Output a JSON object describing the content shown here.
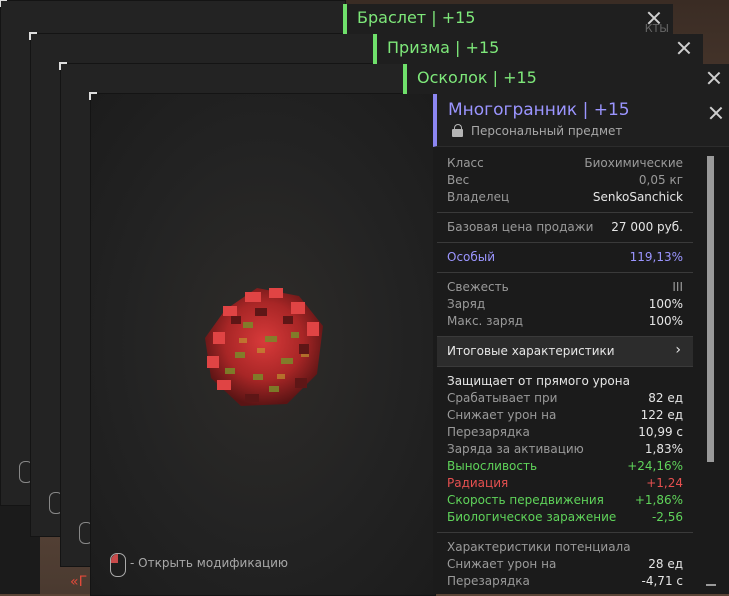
{
  "background": {
    "partial_text": "«Г"
  },
  "stack_tabs": [
    {
      "title": "Браслет | +15",
      "ghost": "КТЫ"
    },
    {
      "title": "Призма | +15"
    },
    {
      "title": "Осколок | +15"
    }
  ],
  "item": {
    "title": "Многогранник | +15",
    "subtitle": "Персональный предмет",
    "info": [
      {
        "k": "Класс",
        "v": "Биохимические"
      },
      {
        "k": "Вес",
        "v": "0,05 кг"
      },
      {
        "k": "Владелец",
        "v": "SenkoSanchick"
      }
    ],
    "price": {
      "k": "Базовая цена продажи",
      "v": "27 000 руб."
    },
    "special": {
      "k": "Особый",
      "v": "119,13%"
    },
    "charge": [
      {
        "k": "Свежесть",
        "v": "III"
      },
      {
        "k": "Заряд",
        "v": "100%"
      },
      {
        "k": "Макс. заряд",
        "v": "100%"
      }
    ],
    "totals_label": "Итоговые характеристики",
    "protect_title": "Защищает от прямого урона",
    "protect": [
      {
        "k": "Срабатывает при",
        "v": "82 ед"
      },
      {
        "k": "Снижает урон на",
        "v": "122 ед"
      },
      {
        "k": "Перезарядка",
        "v": "10,99 с"
      },
      {
        "k": "Заряда за активацию",
        "v": "1,83%"
      },
      {
        "k": "Выносливость",
        "v": "+24,16%"
      },
      {
        "k": "Радиация",
        "v": "+1,24"
      },
      {
        "k": "Скорость передвижения",
        "v": "+1,86%"
      },
      {
        "k": "Биологическое заражение",
        "v": "-2,56"
      }
    ],
    "potential_title": "Характеристики потенциала",
    "potential": [
      {
        "k": "Снижает урон на",
        "v": "28 ед"
      },
      {
        "k": "Перезарядка",
        "v": "-4,71 с"
      }
    ]
  },
  "hint": "- Открыть модификацию",
  "colors": {
    "accent_green": "#6fe06b",
    "accent_purple": "#8c86f2",
    "positive": "#5fd35a",
    "negative": "#e65050"
  },
  "icons": [
    "close-icon",
    "lock-icon",
    "chevron-right-icon",
    "mouse-icon"
  ]
}
